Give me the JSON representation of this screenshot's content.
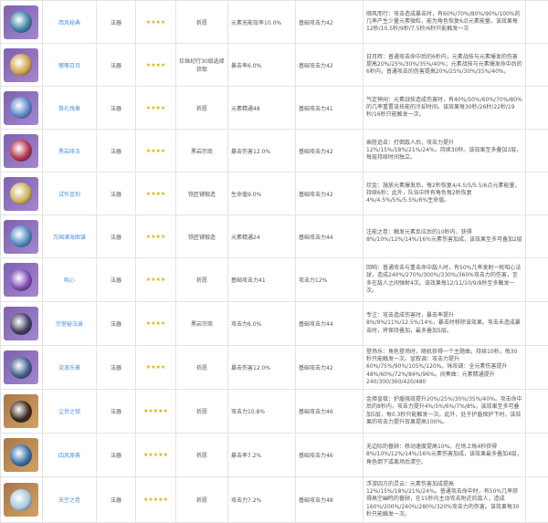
{
  "rows": [
    {
      "name": "西风秘典",
      "type": "法器",
      "stars": "★★★★",
      "source": "祈愿",
      "sub": "元素充能效率10.0%",
      "base": "基础攻击力42",
      "effect": "顺风而行：攻击造成暴击时，有60%/70%/80%/90%/100%的几率产生少量元素微粒，能为角色恢复6点元素能量。该效果每12秒/10.5秒/9秒/7.5秒/6秒只能触发一次",
      "tier": "purple",
      "icon_color": "#3d82a8"
    },
    {
      "name": "嘟嘟日月",
      "type": "法器",
      "stars": "★★★★",
      "source": "珍珠纪行30级选择获取",
      "sub": "暴击率6.0%",
      "base": "基础攻击力42",
      "effect": "日月辉：普通攻击命中后的6秒内，元素战技与元素爆发的伤害提高20%/25%/30%/35%/40%；元素战技与元素爆发命中后的6秒内，普通攻击的伤害提高20%/25%/30%/35%/40%。",
      "tier": "purple",
      "icon_color": "#d1a34b"
    },
    {
      "name": "祭礼残章",
      "type": "法器",
      "stars": "★★★★",
      "source": "祈愿",
      "sub": "元素精通48",
      "base": "基础攻击力41",
      "effect": "气定神闲：元素战技造成伤害时，有40%/50%/60%/70%/80%的几率重置该技能的冷却时间。该效果每30秒/26秒/22秒/19秒/16秒只能触发一次。",
      "tier": "purple",
      "icon_color": "#5b86c9"
    },
    {
      "name": "黑岩绯玉",
      "type": "法器",
      "stars": "★★★★",
      "source": "黑岩宗商",
      "sub": "暴击伤害12.0%",
      "base": "基础攻击力42",
      "effect": "乘胜追击：打倒敌人后，攻击力提升12%/15%/18%/21%/24%，持续30秒。该效果至多叠加3层，每层持续时间独立。",
      "tier": "purple",
      "icon_color": "#b2334c"
    },
    {
      "name": "试作金珀",
      "type": "法器",
      "stars": "★★★★",
      "source": "铁匠铺锻造",
      "sub": "生命值9.0%",
      "base": "基础攻击力42",
      "effect": "炊金：施放元素爆发后，每2秒恢复4/4.5/5/5.5/6点元素能量，持续6秒；此外，队伍中所有角色每2秒恢复4%/4.5%/5%/5.5%/6%生命值。",
      "tier": "purple",
      "icon_color": "#cbb25a"
    },
    {
      "name": "万国诸海图谱",
      "type": "法器",
      "stars": "★★★★",
      "source": "铁匠铺锻造",
      "sub": "元素精通24",
      "base": "基础攻击力44",
      "effect": "注能之卷：触发元素反应后的10秒内，获得8%/10%/12%/14%/16%元素伤害加成，该效果至多可叠加2层",
      "tier": "purple",
      "icon_color": "#4e8bbf"
    },
    {
      "name": "昭心",
      "type": "法器",
      "stars": "★★★★",
      "source": "祈愿",
      "sub": "基础攻击力41",
      "base": "攻击力12%",
      "effect": "回响：普通攻击与重击命中敌人时，有50%几率发射一枚昭心法球，造成240%/270%/300%/330%/360%攻击力的伤害，至多在敌人之间弹射4次。该效果每12/11/10/9/8秒至多触发一次。",
      "tier": "purple",
      "icon_color": "#7e4bb6"
    },
    {
      "name": "宗室秘法录",
      "type": "法器",
      "stars": "★★★★",
      "source": "黑岩宗商",
      "sub": "攻击力6.0%",
      "base": "基础攻击力44",
      "effect": "专注：攻击造成伤害时，暴击率提升8%/9%/11%/12.5%/14%，暴击时移除该效果。攻击未造成暴击时，将保持叠加，最多叠加5层。",
      "tier": "purple",
      "icon_color": "#3f3f61"
    },
    {
      "name": "流浪乐章",
      "type": "法器",
      "stars": "★★★★",
      "source": "祈愿",
      "sub": "暴击伤害12.0%",
      "base": "基础攻击力42",
      "effect": "登场乐：角色登场时，随机获得一个主题曲，持续10秒。每30秒只能触发一次。宣叙调：攻击力提升60%/75%/90%/105%/120%。咏叹调：全元素伤害提升48%/60%/72%/84%/96%。间奏曲：元素精通提升240/300/360/420/480",
      "tier": "purple",
      "icon_color": "#3f5f8c"
    },
    {
      "name": "尘世之锁",
      "type": "法器",
      "stars": "★★★★★",
      "source": "祈愿",
      "sub": "攻击力10.8%",
      "base": "基础攻击力46",
      "effect": "金璋皇极：护盾强效提升20%/25%/30%/35%/40%。攻击命中后的8秒内，攻击力提升4%/5%/6%/7%/8%。该效果至多可叠加5层，每0.3秒只能触发一次。此外，处于护盾保护下时，该效果的攻击力提升效果提高100%。",
      "tier": "gold",
      "icon_color": "#3a2a1a"
    },
    {
      "name": "四风原典",
      "type": "法器",
      "stars": "★★★★★",
      "source": "祈愿",
      "sub": "暴击率7.2%",
      "base": "基础攻击力46",
      "effect": "无边际的眷顾：移动速度提高10%。在场上每4秒获得8%/10%/12%/14%/16%元素伤害加成，该效果最多叠加4层，角色倒下或离场后清空。",
      "tier": "gold",
      "icon_color": "#3a6fa8"
    },
    {
      "name": "天空之卷",
      "type": "法器",
      "stars": "★★★★★",
      "source": "祈愿",
      "sub": "攻击力7.2%",
      "base": "基础攻击力48",
      "effect": "浮游四方的灵云：元素伤害加成提高12%/15%/18%/21%/24%。普通攻击命中时，有50%几率获得高空幽鸣的眷顾，在15秒内主动攻击附近的敌人，造成160%/200%/240%/280%/320%攻击力的伤害。该效果每30秒只能触发一次。",
      "tier": "gold",
      "icon_color": "#a9c8e0"
    }
  ]
}
